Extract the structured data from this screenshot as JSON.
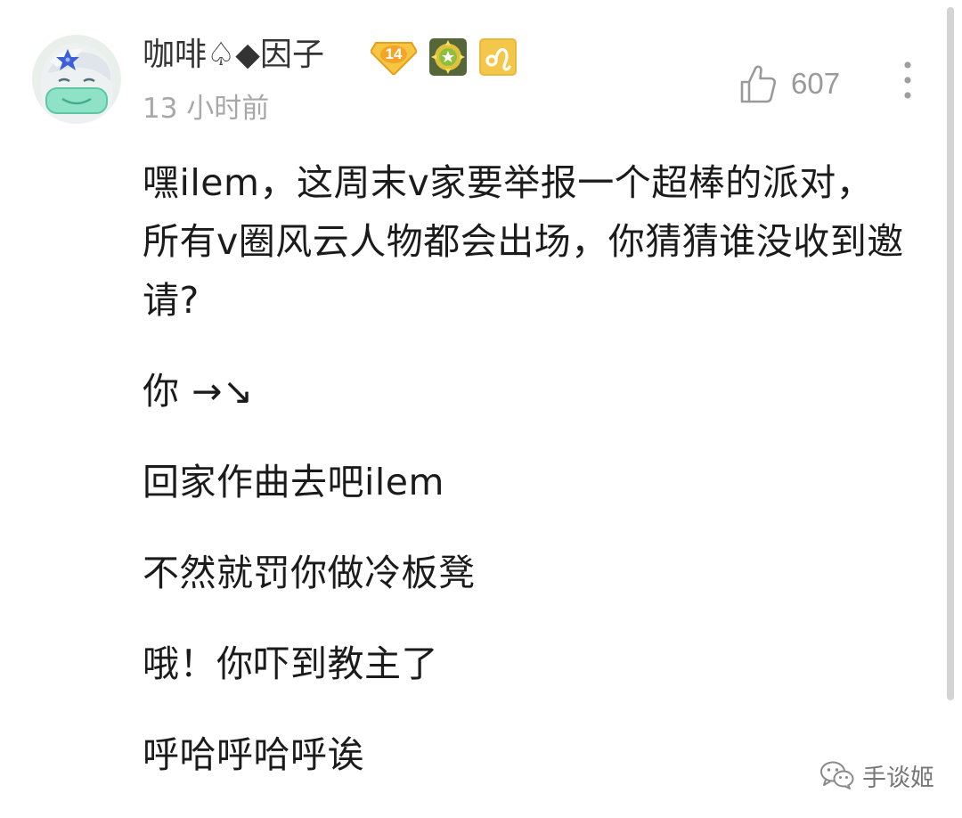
{
  "comment": {
    "author": {
      "name": "咖啡♤◆因子",
      "level": "14",
      "avatar_icon": "anime-girl-mask-avatar",
      "badges": [
        "level-badge",
        "medal-badge",
        "leo-zodiac-badge"
      ]
    },
    "timestamp": "13 小时前",
    "likes": "607",
    "paragraphs": [
      "嘿ilem，这周末v家要举报一个超棒的派对，所有v圈风云人物都会出场，你猜猜谁没收到邀请?",
      "你 →↘",
      "回家作曲去吧ilem",
      "不然就罚你做冷板凳",
      "哦！你吓到教主了",
      "呼哈呼哈呼诶"
    ]
  },
  "watermark": {
    "text": "手谈姬",
    "icon": "wechat-icon"
  },
  "colors": {
    "level_badge": "#f5b731",
    "medal_badge": "#5a6b3c",
    "zodiac_badge": "#e8b93a",
    "text_primary": "#1b1b1b",
    "text_secondary": "#a8a8a8"
  }
}
